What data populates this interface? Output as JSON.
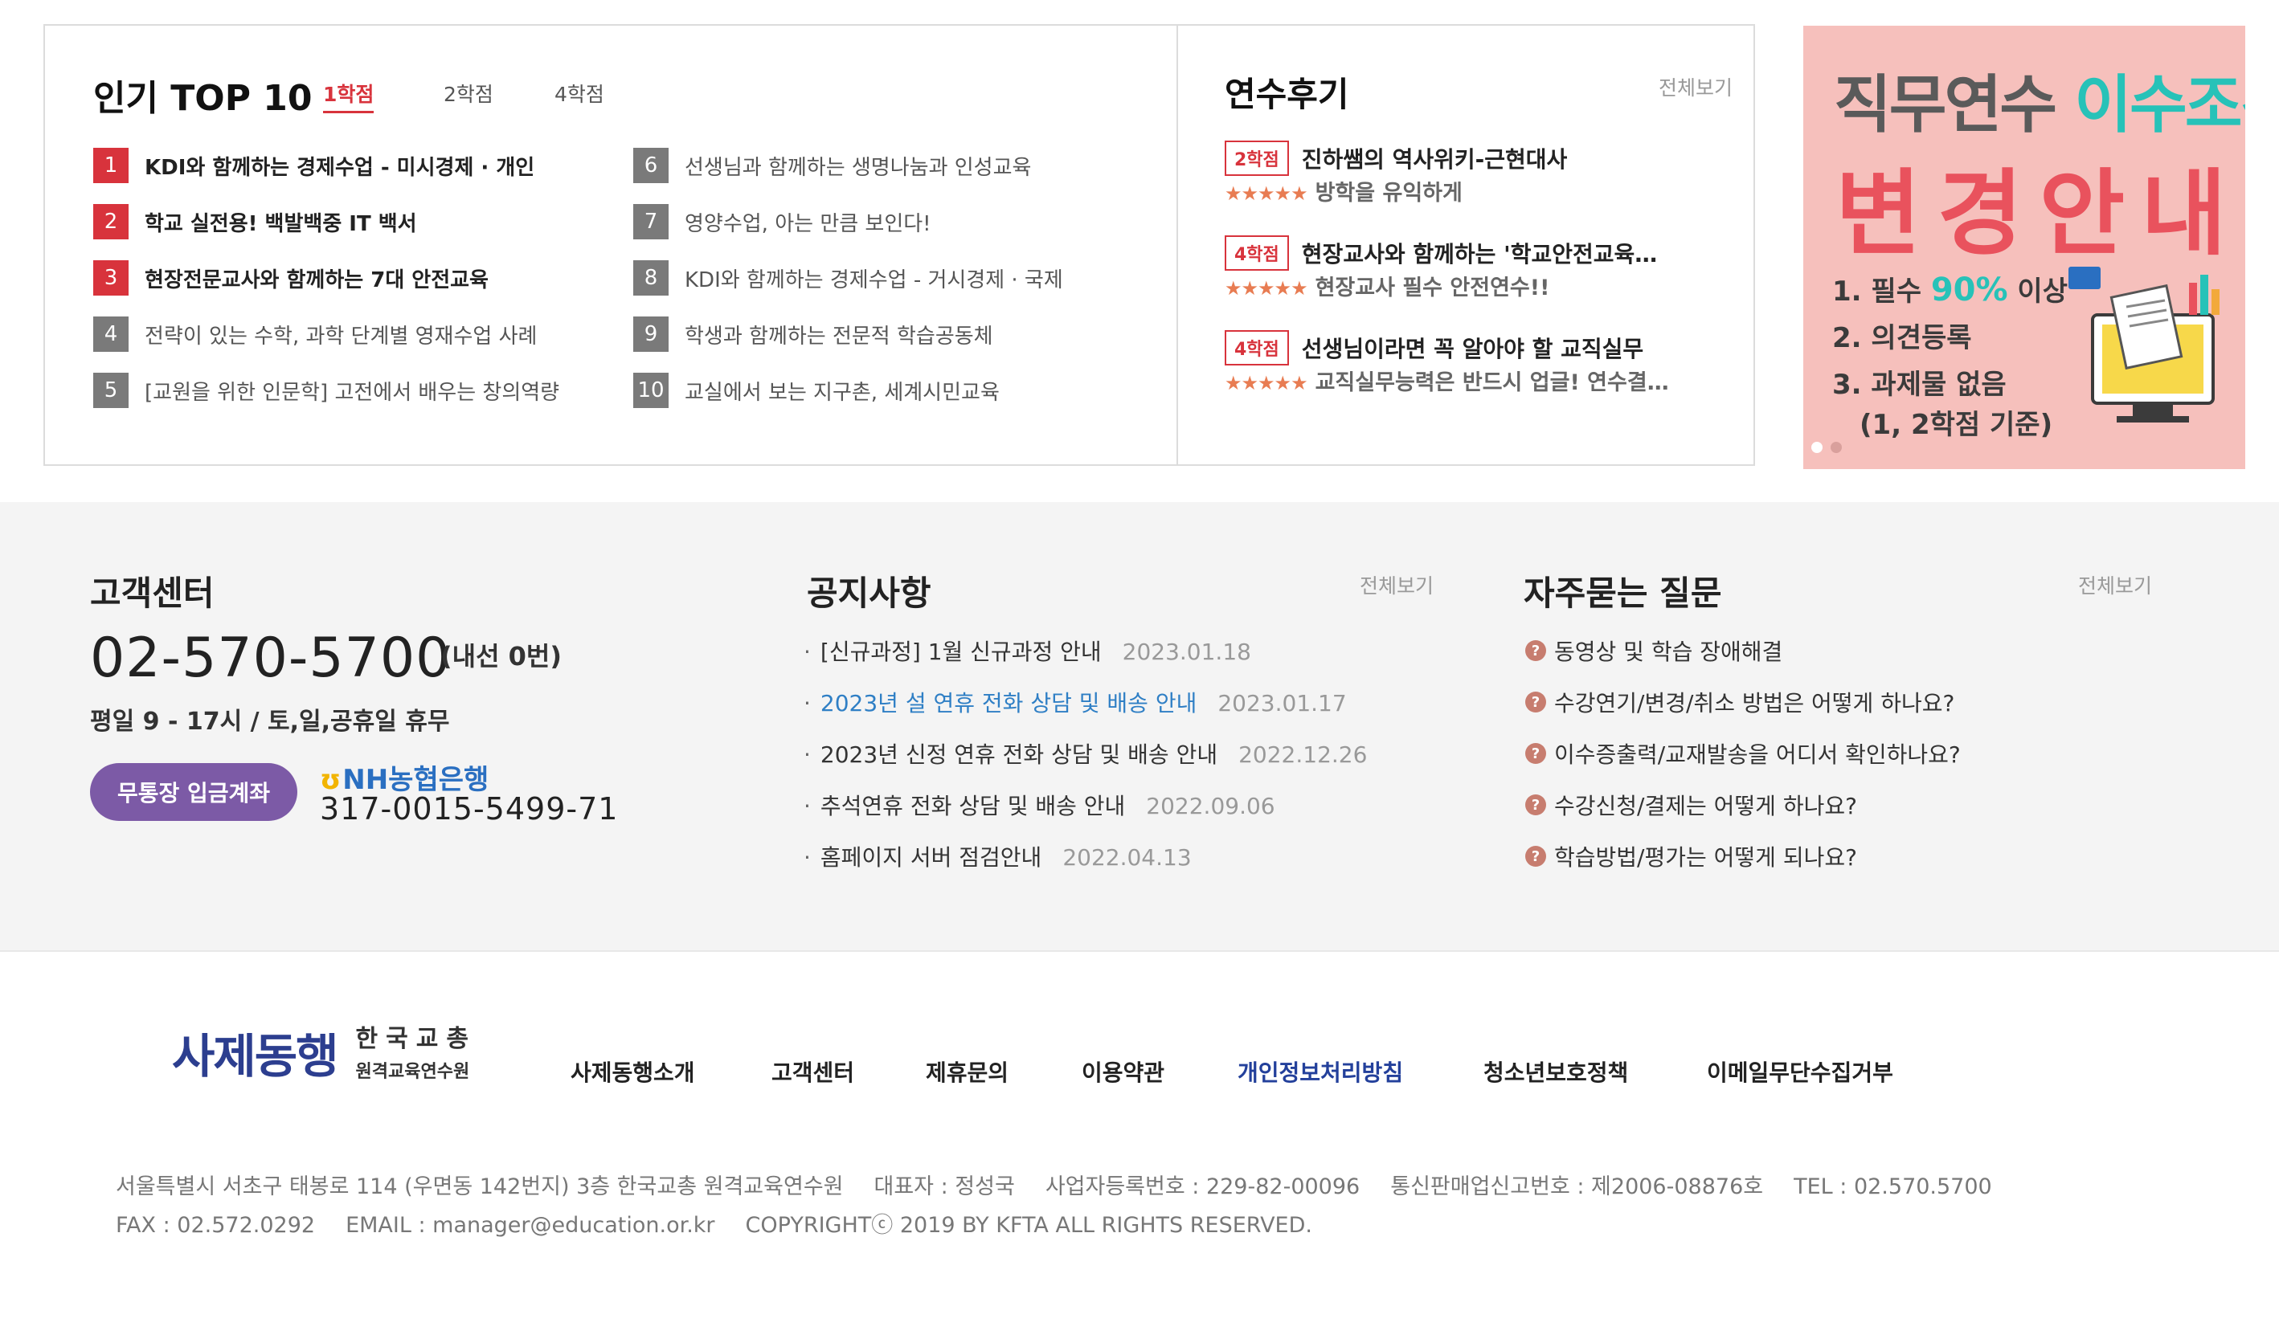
{
  "popular": {
    "title": "인기 TOP 10",
    "tabs": [
      "1학점",
      "2학점",
      "4학점"
    ],
    "active_tab": "1학점",
    "items": [
      {
        "rank": "1",
        "text": "KDI와 함께하는 경제수업 - 미시경제 · 개인"
      },
      {
        "rank": "2",
        "text": "학교 실전용! 백발백중 IT 백서"
      },
      {
        "rank": "3",
        "text": "현장전문교사와 함께하는 7대 안전교육"
      },
      {
        "rank": "4",
        "text": "전략이 있는 수학, 과학 단계별 영재수업 사례"
      },
      {
        "rank": "5",
        "text": "[교원을 위한 인문학] 고전에서 배우는 창의역량"
      },
      {
        "rank": "6",
        "text": "선생님과 함께하는 생명나눔과 인성교육"
      },
      {
        "rank": "7",
        "text": "영양수업, 아는 만큼 보인다!"
      },
      {
        "rank": "8",
        "text": "KDI와 함께하는 경제수업 - 거시경제 · 국제"
      },
      {
        "rank": "9",
        "text": "학생과 함께하는 전문적 학습공동체"
      },
      {
        "rank": "10",
        "text": "교실에서 보는 지구촌, 세계시민교육"
      }
    ]
  },
  "reviews": {
    "title": "연수후기",
    "more": "전체보기",
    "stars": "★★★★★",
    "items": [
      {
        "badge": "2학점",
        "name": "진하쌤의 역사위키-근현대사",
        "body": "방학을 유익하게"
      },
      {
        "badge": "4학점",
        "name": "현장교사와 함께하는 '학교안전교육…",
        "body": "현장교사 필수 안전연수!!"
      },
      {
        "badge": "4학점",
        "name": "선생님이라면 꼭 알아야 할 교직실무",
        "body": "교직실무능력은 반드시 업글! 연수결…"
      }
    ]
  },
  "banner": {
    "line1_a": "직무연수",
    "line1_b": "이수조건",
    "line2": "변경안내",
    "item1_a": "1. 필수",
    "item1_b": "90%",
    "item1_c": "이상",
    "item2": "2. 의견등록",
    "item3": "3. 과제물 없음",
    "item3_sub": "(1, 2학점 기준)"
  },
  "customer_center": {
    "title": "고객센터",
    "phone": "02-570-5700",
    "extension": "(내선 0번)",
    "hours": "평일 9 - 17시 / 토,일,공휴일 휴무",
    "deposit_label": "무통장 입금계좌",
    "bank_name": "NH농협은행",
    "account": "317-0015-5499-71"
  },
  "notices": {
    "title": "공지사항",
    "more": "전체보기",
    "items": [
      {
        "text": "[신규과정] 1월 신규과정 안내",
        "date": "2023.01.18"
      },
      {
        "text": "2023년 설 연휴 전화 상담 및 배송 안내",
        "date": "2023.01.17"
      },
      {
        "text": "2023년 신정 연휴 전화 상담 및 배송 안내",
        "date": "2022.12.26"
      },
      {
        "text": "추석연휴 전화 상담 및 배송 안내",
        "date": "2022.09.06"
      },
      {
        "text": "홈페이지 서버 점검안내",
        "date": "2022.04.13"
      }
    ]
  },
  "faq": {
    "title": "자주묻는 질문",
    "more": "전체보기",
    "items": [
      "동영상 및 학습 장애해결",
      "수강연기/변경/취소 방법은 어떻게 하나요?",
      "이수증출력/교재발송을 어디서 확인하나요?",
      "수강신청/결제는 어떻게 하나요?",
      "학습방법/평가는 어떻게 되나요?"
    ]
  },
  "footer": {
    "logo_main": "사제동행",
    "logo_sub1": "한국교총",
    "logo_sub2": "원격교육연수원",
    "links": [
      "사제동행소개",
      "고객센터",
      "제휴문의",
      "이용약관",
      "개인정보처리방침",
      "청소년보호정책",
      "이메일무단수집거부"
    ],
    "address": "서울특별시 서초구 태봉로 114 (우면동 142번지) 3층 한국교총 원격교육연수원",
    "ceo": "대표자 : 정성국",
    "biz_no": "사업자등록번호 : 229-82-00096",
    "mail_order": "통신판매업신고번호 : 제2006-08876호",
    "tel": "TEL : 02.570.5700",
    "fax": "FAX : 02.572.0292",
    "email": "EMAIL : manager@education.or.kr",
    "copyright": "COPYRIGHTⓒ 2019 BY KFTA ALL RIGHTS RESERVED."
  },
  "colors": {
    "accent_red": "#d8333c",
    "nh_purple": "#7c5aa6",
    "link_blue": "#2f7fc5",
    "footer_highlight": "#23409b"
  }
}
